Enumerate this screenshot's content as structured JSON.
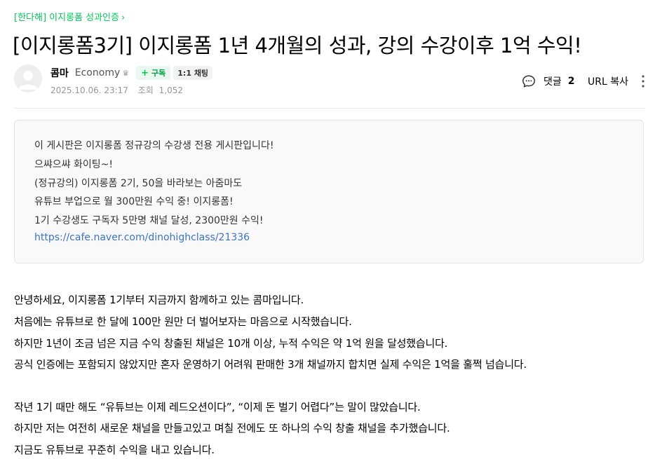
{
  "board": {
    "name": "[한다해] 이지롱폼 성과인증",
    "chevron": "›"
  },
  "post": {
    "title": "[이지롱폼3기] 이지롱폼 1년 4개월의 성과, 강의 수강이후 1억 수익!",
    "author": {
      "name": "콤마",
      "grade": "Economy",
      "grade_icon": "crown-icon",
      "avatar_icon": "default-profile-icon"
    },
    "subscribe_label": "구독",
    "chat_label": "1:1 채팅",
    "date": "2025.10.06. 23:17",
    "views_label": "조회",
    "views_count": "1,052",
    "comment_label": "댓글",
    "comment_count": "2",
    "url_copy_label": "URL 복사"
  },
  "notice": {
    "lines": [
      "이 게시판은 이지롱폼 정규강의 수강생 전용 게시판입니다!",
      "으쌰으쌰 화이팅~!",
      "(정규강의) 이지롱폼 2기, 50을 바라보는 아줌마도",
      "유튜브 부업으로 월 300만원 수익 중! 이지롱폼!",
      "1기 수강생도 구독자 5만명 채널 달성, 2300만원 수익!"
    ],
    "link": "https://cafe.naver.com/dinohighclass/21336"
  },
  "body": {
    "paragraph1": [
      "안녕하세요, 이지롱폼 1기부터 지금까지 함께하고 있는 콤마입니다.",
      "처음에는 유튜브로 한 달에 100만 원만 더 벌어보자는 마음으로 시작했습니다.",
      "하지만 1년이 조금 넘은 지금 수익 창출된 채널은 10개 이상, 누적 수익은 약 1억 원을 달성했습니다.",
      "공식 인증에는 포함되지 않았지만 혼자 운영하기 어려워 판매한 3개 채널까지 합치면 실제 수익은 1억을 훌쩍 넘습니다."
    ],
    "paragraph2": [
      "작년 1기 때만 해도 “유튜브는 이제 레드오션이다”, “이제 돈 벌기 어렵다”는 말이 많았습니다.",
      "하지만 저는 여전히 새로운 채널을 만들고있고 며칠 전에도 또 하나의 수익 창출 채널을 추가했습니다.",
      "지금도 유튜브로 꾸준히 수익을 내고 있습니다."
    ]
  },
  "colors": {
    "accent_green": "#03c75a",
    "link_blue": "#3b73c6",
    "meta_gray": "#979797"
  }
}
